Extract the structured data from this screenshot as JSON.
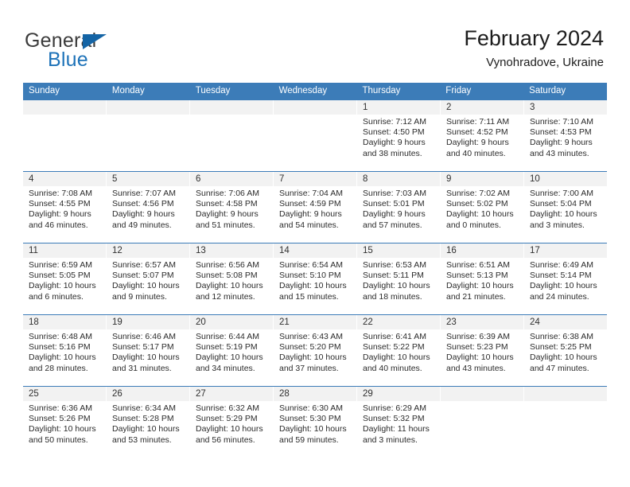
{
  "logo": {
    "word_one": "General",
    "word_two": "Blue",
    "triangle_color": "#1464a5",
    "blue_color": "#1d72b8"
  },
  "header": {
    "title": "February 2024",
    "subtitle": "Vynohradove, Ukraine"
  },
  "theme": {
    "header_blue": "#3c7cb8",
    "day_band_gray": "#f2f2f2"
  },
  "weekdays": [
    "Sunday",
    "Monday",
    "Tuesday",
    "Wednesday",
    "Thursday",
    "Friday",
    "Saturday"
  ],
  "weeks": [
    [
      {
        "day": ""
      },
      {
        "day": ""
      },
      {
        "day": ""
      },
      {
        "day": ""
      },
      {
        "day": "1",
        "sunrise": "Sunrise: 7:12 AM",
        "sunset": "Sunset: 4:50 PM",
        "daylight_1": "Daylight: 9 hours",
        "daylight_2": "and 38 minutes."
      },
      {
        "day": "2",
        "sunrise": "Sunrise: 7:11 AM",
        "sunset": "Sunset: 4:52 PM",
        "daylight_1": "Daylight: 9 hours",
        "daylight_2": "and 40 minutes."
      },
      {
        "day": "3",
        "sunrise": "Sunrise: 7:10 AM",
        "sunset": "Sunset: 4:53 PM",
        "daylight_1": "Daylight: 9 hours",
        "daylight_2": "and 43 minutes."
      }
    ],
    [
      {
        "day": "4",
        "sunrise": "Sunrise: 7:08 AM",
        "sunset": "Sunset: 4:55 PM",
        "daylight_1": "Daylight: 9 hours",
        "daylight_2": "and 46 minutes."
      },
      {
        "day": "5",
        "sunrise": "Sunrise: 7:07 AM",
        "sunset": "Sunset: 4:56 PM",
        "daylight_1": "Daylight: 9 hours",
        "daylight_2": "and 49 minutes."
      },
      {
        "day": "6",
        "sunrise": "Sunrise: 7:06 AM",
        "sunset": "Sunset: 4:58 PM",
        "daylight_1": "Daylight: 9 hours",
        "daylight_2": "and 51 minutes."
      },
      {
        "day": "7",
        "sunrise": "Sunrise: 7:04 AM",
        "sunset": "Sunset: 4:59 PM",
        "daylight_1": "Daylight: 9 hours",
        "daylight_2": "and 54 minutes."
      },
      {
        "day": "8",
        "sunrise": "Sunrise: 7:03 AM",
        "sunset": "Sunset: 5:01 PM",
        "daylight_1": "Daylight: 9 hours",
        "daylight_2": "and 57 minutes."
      },
      {
        "day": "9",
        "sunrise": "Sunrise: 7:02 AM",
        "sunset": "Sunset: 5:02 PM",
        "daylight_1": "Daylight: 10 hours",
        "daylight_2": "and 0 minutes."
      },
      {
        "day": "10",
        "sunrise": "Sunrise: 7:00 AM",
        "sunset": "Sunset: 5:04 PM",
        "daylight_1": "Daylight: 10 hours",
        "daylight_2": "and 3 minutes."
      }
    ],
    [
      {
        "day": "11",
        "sunrise": "Sunrise: 6:59 AM",
        "sunset": "Sunset: 5:05 PM",
        "daylight_1": "Daylight: 10 hours",
        "daylight_2": "and 6 minutes."
      },
      {
        "day": "12",
        "sunrise": "Sunrise: 6:57 AM",
        "sunset": "Sunset: 5:07 PM",
        "daylight_1": "Daylight: 10 hours",
        "daylight_2": "and 9 minutes."
      },
      {
        "day": "13",
        "sunrise": "Sunrise: 6:56 AM",
        "sunset": "Sunset: 5:08 PM",
        "daylight_1": "Daylight: 10 hours",
        "daylight_2": "and 12 minutes."
      },
      {
        "day": "14",
        "sunrise": "Sunrise: 6:54 AM",
        "sunset": "Sunset: 5:10 PM",
        "daylight_1": "Daylight: 10 hours",
        "daylight_2": "and 15 minutes."
      },
      {
        "day": "15",
        "sunrise": "Sunrise: 6:53 AM",
        "sunset": "Sunset: 5:11 PM",
        "daylight_1": "Daylight: 10 hours",
        "daylight_2": "and 18 minutes."
      },
      {
        "day": "16",
        "sunrise": "Sunrise: 6:51 AM",
        "sunset": "Sunset: 5:13 PM",
        "daylight_1": "Daylight: 10 hours",
        "daylight_2": "and 21 minutes."
      },
      {
        "day": "17",
        "sunrise": "Sunrise: 6:49 AM",
        "sunset": "Sunset: 5:14 PM",
        "daylight_1": "Daylight: 10 hours",
        "daylight_2": "and 24 minutes."
      }
    ],
    [
      {
        "day": "18",
        "sunrise": "Sunrise: 6:48 AM",
        "sunset": "Sunset: 5:16 PM",
        "daylight_1": "Daylight: 10 hours",
        "daylight_2": "and 28 minutes."
      },
      {
        "day": "19",
        "sunrise": "Sunrise: 6:46 AM",
        "sunset": "Sunset: 5:17 PM",
        "daylight_1": "Daylight: 10 hours",
        "daylight_2": "and 31 minutes."
      },
      {
        "day": "20",
        "sunrise": "Sunrise: 6:44 AM",
        "sunset": "Sunset: 5:19 PM",
        "daylight_1": "Daylight: 10 hours",
        "daylight_2": "and 34 minutes."
      },
      {
        "day": "21",
        "sunrise": "Sunrise: 6:43 AM",
        "sunset": "Sunset: 5:20 PM",
        "daylight_1": "Daylight: 10 hours",
        "daylight_2": "and 37 minutes."
      },
      {
        "day": "22",
        "sunrise": "Sunrise: 6:41 AM",
        "sunset": "Sunset: 5:22 PM",
        "daylight_1": "Daylight: 10 hours",
        "daylight_2": "and 40 minutes."
      },
      {
        "day": "23",
        "sunrise": "Sunrise: 6:39 AM",
        "sunset": "Sunset: 5:23 PM",
        "daylight_1": "Daylight: 10 hours",
        "daylight_2": "and 43 minutes."
      },
      {
        "day": "24",
        "sunrise": "Sunrise: 6:38 AM",
        "sunset": "Sunset: 5:25 PM",
        "daylight_1": "Daylight: 10 hours",
        "daylight_2": "and 47 minutes."
      }
    ],
    [
      {
        "day": "25",
        "sunrise": "Sunrise: 6:36 AM",
        "sunset": "Sunset: 5:26 PM",
        "daylight_1": "Daylight: 10 hours",
        "daylight_2": "and 50 minutes."
      },
      {
        "day": "26",
        "sunrise": "Sunrise: 6:34 AM",
        "sunset": "Sunset: 5:28 PM",
        "daylight_1": "Daylight: 10 hours",
        "daylight_2": "and 53 minutes."
      },
      {
        "day": "27",
        "sunrise": "Sunrise: 6:32 AM",
        "sunset": "Sunset: 5:29 PM",
        "daylight_1": "Daylight: 10 hours",
        "daylight_2": "and 56 minutes."
      },
      {
        "day": "28",
        "sunrise": "Sunrise: 6:30 AM",
        "sunset": "Sunset: 5:30 PM",
        "daylight_1": "Daylight: 10 hours",
        "daylight_2": "and 59 minutes."
      },
      {
        "day": "29",
        "sunrise": "Sunrise: 6:29 AM",
        "sunset": "Sunset: 5:32 PM",
        "daylight_1": "Daylight: 11 hours",
        "daylight_2": "and 3 minutes."
      },
      {
        "day": ""
      },
      {
        "day": ""
      }
    ]
  ]
}
